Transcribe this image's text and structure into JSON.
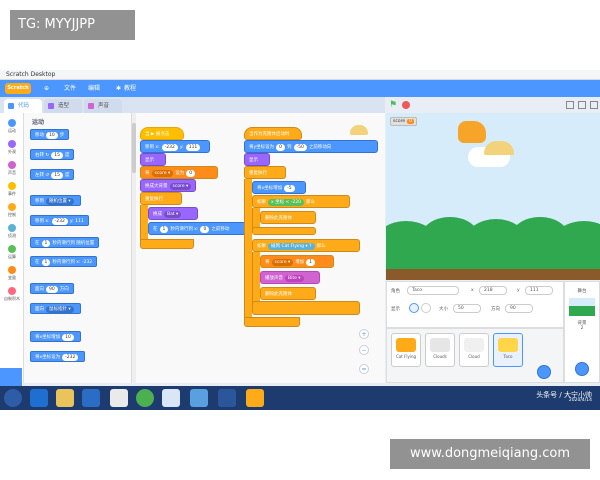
{
  "watermark_top": "TG: MYYJJPP",
  "watermark_bottom": "www.dongmeiqiang.com",
  "window_title": "Scratch Desktop",
  "menubar": {
    "logo": "Scratch",
    "globe": "⊕",
    "file": "文件",
    "edit": "编辑",
    "tutorials": "教程"
  },
  "tabs": {
    "code": "代码",
    "costumes": "造型",
    "sounds": "声音"
  },
  "categories": [
    {
      "label": "运动",
      "color": "#4c97ff"
    },
    {
      "label": "外观",
      "color": "#9966ff"
    },
    {
      "label": "声音",
      "color": "#cf63cf"
    },
    {
      "label": "事件",
      "color": "#ffbf00"
    },
    {
      "label": "控制",
      "color": "#ffab19"
    },
    {
      "label": "侦测",
      "color": "#5cb1d6"
    },
    {
      "label": "运算",
      "color": "#59c059"
    },
    {
      "label": "变量",
      "color": "#ff8c1a"
    },
    {
      "label": "自制积木",
      "color": "#ff6680"
    }
  ],
  "palette": {
    "heading": "运动",
    "blocks": [
      {
        "text": "移动",
        "value": "10",
        "suffix": "步"
      },
      {
        "text": "右转 ↻",
        "value": "15",
        "suffix": "度"
      },
      {
        "text": "左转 ↺",
        "value": "15",
        "suffix": "度"
      },
      {
        "text": "移到",
        "value": "随机位置 ▾",
        "suffix": ""
      },
      {
        "text": "移到 x:",
        "value": "-232",
        "suffix": "y: 111"
      },
      {
        "text": "在",
        "value": "1",
        "suffix": "秒内滑行到 随机位置"
      },
      {
        "text": "在",
        "value": "1",
        "suffix": "秒内滑行到 x: -232"
      },
      {
        "text": "面向",
        "value": "90",
        "suffix": "方向"
      },
      {
        "text": "面向",
        "value": "鼠标指针 ▾",
        "suffix": ""
      },
      {
        "text": "将x坐标增加",
        "value": "10",
        "suffix": ""
      },
      {
        "text": "将x坐标设为",
        "value": "-232",
        "suffix": ""
      }
    ]
  },
  "script1": {
    "hat": "当 ▶ 被点击",
    "goto": "移到 x:",
    "goto_x": "-232",
    "goto_y_label": "y:",
    "goto_y": "111",
    "show": "显示",
    "set_var": "将",
    "var_name": "score ▾",
    "set_to": "设为",
    "set_val": "0",
    "switch_costume": "换成大背景",
    "costume": "score ▾",
    "forever": "重复执行",
    "costume_next": "换成",
    "costume_val": "Bat ▾",
    "glide": "在",
    "glide_secs": "1",
    "glide_mid": "秒内滑行到 x:",
    "glide_x": "0",
    "glide_end": "之前移动"
  },
  "script2": {
    "hat": "当作为克隆体启动时",
    "goto": "将y坐标设为",
    "goto_val": "0",
    "mid": "到",
    "val2": "-50",
    "end": "之前移动向",
    "show": "显示",
    "forever": "重复执行",
    "change_x": "将x坐标增加",
    "change_x_val": "-5",
    "if1": "如果",
    "cond1_lhs": "x 坐标",
    "cond1_op": "<",
    "cond1_rhs": "-220",
    "then": "那么",
    "delete1": "删除此克隆体",
    "if2": "如果",
    "touch": "碰到",
    "touch_target": "Cat Flying ▾",
    "q": "?",
    "then2": "那么",
    "add": "将",
    "add_var": "score ▾",
    "add_mid": "增加",
    "add_val": "1",
    "sound": "播放声音",
    "sound_val": "Bite ▾",
    "delete2": "删除此克隆体"
  },
  "zoom": {
    "in": "+",
    "out": "−",
    "reset": "="
  },
  "stage": {
    "score_label": "score",
    "score_value": "0"
  },
  "sprite_info": {
    "sprite_label": "角色",
    "sprite_name": "Taco",
    "x_label": "x",
    "x_value": "218",
    "y_label": "y",
    "y_value": "111",
    "show_label": "显示",
    "size_label": "大小",
    "size_value": "50",
    "dir_label": "方向",
    "dir_value": "90"
  },
  "sprites": [
    {
      "name": "Cat Flying",
      "color": "#ffab19"
    },
    {
      "name": "Clouds",
      "color": "#e6e6e6"
    },
    {
      "name": "Cloud",
      "color": "#f0f0f0"
    },
    {
      "name": "Taco",
      "color": "#ffd54a"
    }
  ],
  "stage_panel": {
    "title": "舞台",
    "backdrops_label": "背景",
    "backdrops_count": "2"
  },
  "taskbar": {
    "time": "",
    "date": "2020/4/14"
  },
  "corner_text": "头条号 / 大宁小帅"
}
